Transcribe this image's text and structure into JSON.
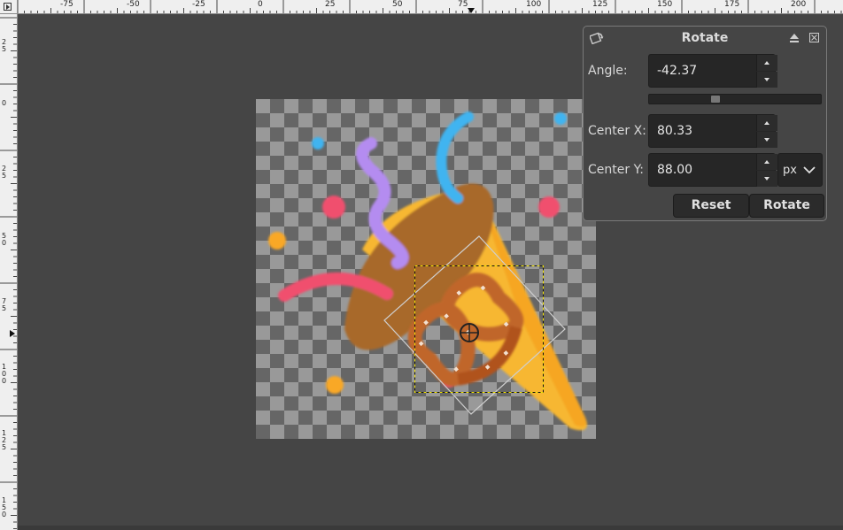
{
  "rulers": {
    "horizontal_labels": [
      "-75",
      "-50",
      "-25",
      "0",
      "25",
      "50",
      "75",
      "100",
      "125",
      "150",
      "175",
      "200"
    ],
    "vertical_labels": [
      "25",
      "0",
      "25",
      "50",
      "75",
      "100",
      "125",
      "150"
    ]
  },
  "dialog": {
    "title": "Rotate",
    "tool_icon": "rotate-tool-icon",
    "angle": {
      "label": "Angle:",
      "value": "-42.37",
      "slider_fraction": 0.38
    },
    "center_x": {
      "label": "Center X:",
      "value": "80.33"
    },
    "center_y": {
      "label": "Center Y:",
      "value": "88.00"
    },
    "unit": "px",
    "reset_label": "Reset",
    "rotate_label": "Rotate"
  },
  "colors": {
    "background": "#454545",
    "cone": "#f7b733",
    "cone_rim": "#a8692a",
    "confetti_blue": "#3fb4f0",
    "confetti_pink": "#f0506e",
    "confetti_orange": "#f9a825",
    "streamer_purple": "#b48cf0"
  }
}
